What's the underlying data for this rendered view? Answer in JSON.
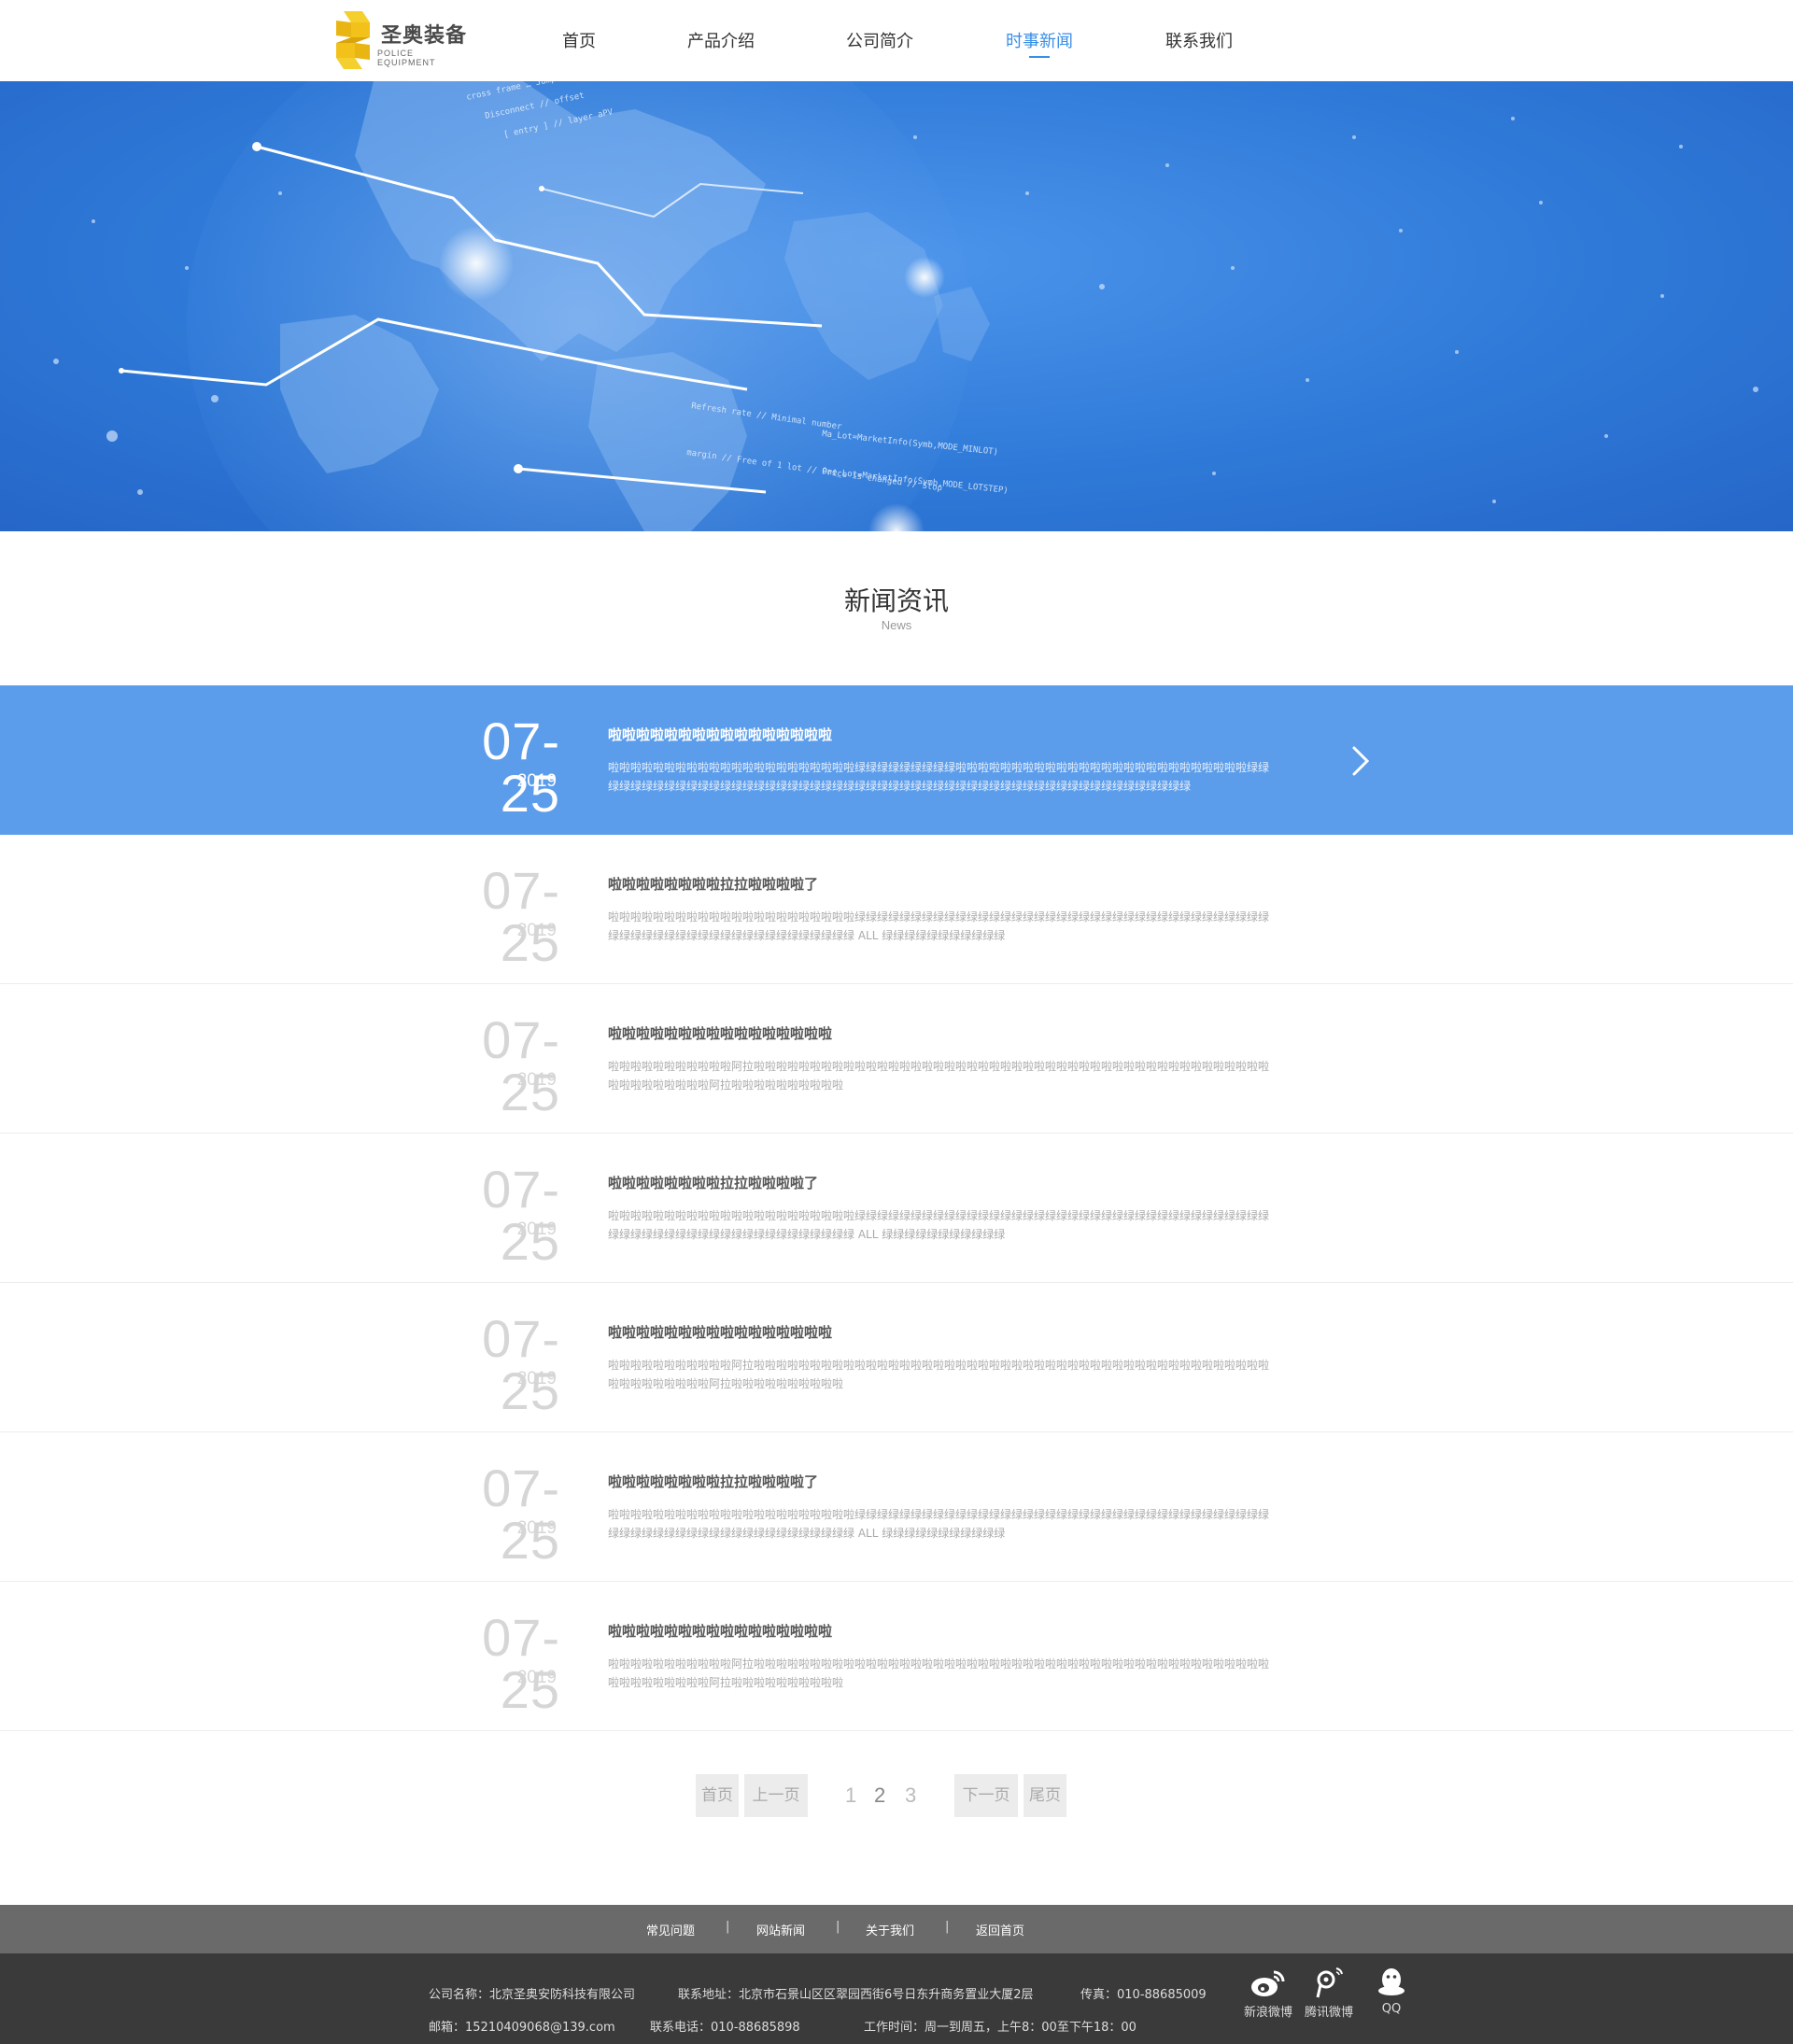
{
  "header": {
    "logo_cn": "圣奥装备",
    "logo_en": "POLICE EQUIPMENT",
    "nav": [
      {
        "label": "首页"
      },
      {
        "label": "产品介绍"
      },
      {
        "label": "公司简介"
      },
      {
        "label": "时事新闻",
        "active": true
      },
      {
        "label": "联系我们"
      }
    ]
  },
  "banner": {
    "code_text_1": "Refresh rate // Minimal number",
    "code_text_2": "margin // Free of 1 lot // Price is changed // Stop"
  },
  "section": {
    "title": "新闻资讯",
    "subtitle": "News"
  },
  "news": [
    {
      "date": "07-25",
      "year": "2019",
      "title": "啦啦啦啦啦啦啦啦啦啦啦啦啦啦啦啦",
      "desc": "啦啦啦啦啦啦啦啦啦啦啦啦啦啦啦啦啦啦啦啦啦啦绿绿绿绿绿绿绿绿绿啦啦啦啦啦啦啦啦啦啦啦啦啦啦啦啦啦啦啦啦啦啦啦啦啦啦绿绿绿绿绿绿绿绿绿绿绿绿绿绿绿绿绿绿绿绿绿绿绿绿绿绿绿绿绿绿绿绿绿绿绿绿绿绿绿绿绿绿绿绿绿绿绿绿绿绿绿绿绿绿",
      "active": true
    },
    {
      "date": "07-25",
      "year": "2019",
      "title": "啦啦啦啦啦啦啦啦拉拉啦啦啦啦了",
      "desc": "啦啦啦啦啦啦啦啦啦啦啦啦啦啦啦啦啦啦啦啦啦啦绿绿绿绿绿绿绿绿绿绿绿绿绿绿绿绿绿绿绿绿绿绿绿绿绿绿绿绿绿绿绿绿绿绿绿绿绿绿绿绿绿绿绿绿绿绿绿绿绿绿绿绿绿绿绿绿绿绿绿 ALL 绿绿绿绿绿绿绿绿绿绿绿"
    },
    {
      "date": "07-25",
      "year": "2019",
      "title": "啦啦啦啦啦啦啦啦啦啦啦啦啦啦啦啦",
      "desc": "啦啦啦啦啦啦啦啦啦啦啦阿拉啦啦啦啦啦啦啦啦啦啦啦啦啦啦啦啦啦啦啦啦啦啦啦啦啦啦啦啦啦啦啦啦啦啦啦啦啦啦啦啦啦啦啦啦啦啦啦啦啦啦啦啦啦啦啦阿拉啦啦啦啦啦啦啦啦啦啦"
    },
    {
      "date": "07-25",
      "year": "2019",
      "title": "啦啦啦啦啦啦啦啦拉拉啦啦啦啦了",
      "desc": "啦啦啦啦啦啦啦啦啦啦啦啦啦啦啦啦啦啦啦啦啦啦绿绿绿绿绿绿绿绿绿绿绿绿绿绿绿绿绿绿绿绿绿绿绿绿绿绿绿绿绿绿绿绿绿绿绿绿绿绿绿绿绿绿绿绿绿绿绿绿绿绿绿绿绿绿绿绿绿绿绿 ALL 绿绿绿绿绿绿绿绿绿绿绿"
    },
    {
      "date": "07-25",
      "year": "2019",
      "title": "啦啦啦啦啦啦啦啦啦啦啦啦啦啦啦啦",
      "desc": "啦啦啦啦啦啦啦啦啦啦啦阿拉啦啦啦啦啦啦啦啦啦啦啦啦啦啦啦啦啦啦啦啦啦啦啦啦啦啦啦啦啦啦啦啦啦啦啦啦啦啦啦啦啦啦啦啦啦啦啦啦啦啦啦啦啦啦啦阿拉啦啦啦啦啦啦啦啦啦啦"
    },
    {
      "date": "07-25",
      "year": "2019",
      "title": "啦啦啦啦啦啦啦啦拉拉啦啦啦啦了",
      "desc": "啦啦啦啦啦啦啦啦啦啦啦啦啦啦啦啦啦啦啦啦啦啦绿绿绿绿绿绿绿绿绿绿绿绿绿绿绿绿绿绿绿绿绿绿绿绿绿绿绿绿绿绿绿绿绿绿绿绿绿绿绿绿绿绿绿绿绿绿绿绿绿绿绿绿绿绿绿绿绿绿绿 ALL 绿绿绿绿绿绿绿绿绿绿绿"
    },
    {
      "date": "07-25",
      "year": "2019",
      "title": "啦啦啦啦啦啦啦啦啦啦啦啦啦啦啦啦",
      "desc": "啦啦啦啦啦啦啦啦啦啦啦阿拉啦啦啦啦啦啦啦啦啦啦啦啦啦啦啦啦啦啦啦啦啦啦啦啦啦啦啦啦啦啦啦啦啦啦啦啦啦啦啦啦啦啦啦啦啦啦啦啦啦啦啦啦啦啦啦阿拉啦啦啦啦啦啦啦啦啦啦"
    }
  ],
  "pagination": {
    "first": "首页",
    "prev": "上一页",
    "pages": [
      "1",
      "2",
      "3"
    ],
    "current": "2",
    "next": "下一页",
    "last": "尾页"
  },
  "footer": {
    "links": [
      "常见问题",
      "网站新闻",
      "关于我们",
      "返回首页"
    ],
    "separator": "|",
    "company": "公司名称：北京圣奥安防科技有限公司",
    "address": "联系地址：北京市石景山区区翠园西街6号日东升商务置业大厦2层",
    "fax": "传真：010-88685009",
    "email": "邮箱：15210409068@139.com",
    "phone": "联系电话：010-88685898",
    "hours": "工作时间：周一到周五，上午8：00至下午18：00",
    "social": [
      {
        "label": "新浪微博",
        "icon": "weibo-icon"
      },
      {
        "label": "腾讯微博",
        "icon": "tencent-weibo-icon"
      },
      {
        "label": "QQ",
        "icon": "qq-icon"
      }
    ]
  },
  "colors": {
    "accent": "#3a8ee6",
    "active_row": "#5c9deb",
    "banner": "#2f7ad8",
    "logo_yellow": "#f2c21b",
    "footer_links_bg": "#6a6a6a",
    "footer_info_bg": "#3a3a3a"
  }
}
